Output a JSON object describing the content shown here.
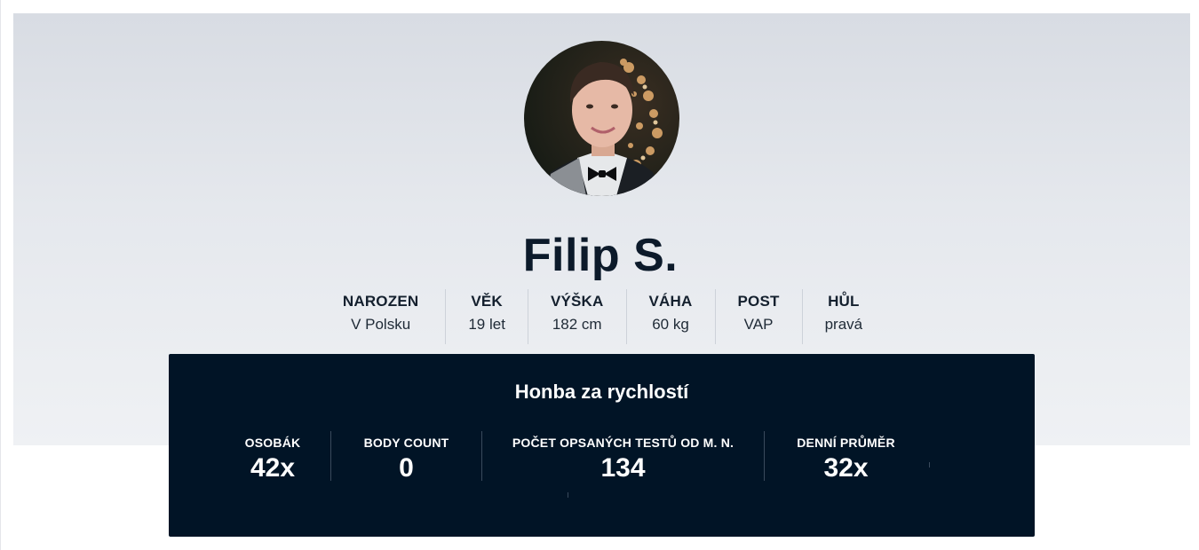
{
  "profile": {
    "name": "Filip S.",
    "avatar_icon": "profile-photo",
    "facts": [
      {
        "label": "NAROZEN",
        "value": "V Polsku"
      },
      {
        "label": "VĚK",
        "value": "19 let"
      },
      {
        "label": "VÝŠKA",
        "value": "182 cm"
      },
      {
        "label": "VÁHA",
        "value": "60 kg"
      },
      {
        "label": "POST",
        "value": "VAP"
      },
      {
        "label": "HŮL",
        "value": "pravá"
      }
    ]
  },
  "panel": {
    "title": "Honba za rychlostí",
    "stats": [
      {
        "label": "OSOBÁK",
        "value": "42x"
      },
      {
        "label": "BODY COUNT",
        "value": "0"
      },
      {
        "label": "POČET OPSANÝCH TESTŮ OD M. N.",
        "value": "134"
      },
      {
        "label": "DENNÍ PRŮMĚR",
        "value": "32x"
      }
    ]
  },
  "colors": {
    "panel_bg": "#011426",
    "hero_top": "#d8dce3",
    "hero_bottom": "#eff1f4",
    "name_text": "#0c1a2a"
  }
}
